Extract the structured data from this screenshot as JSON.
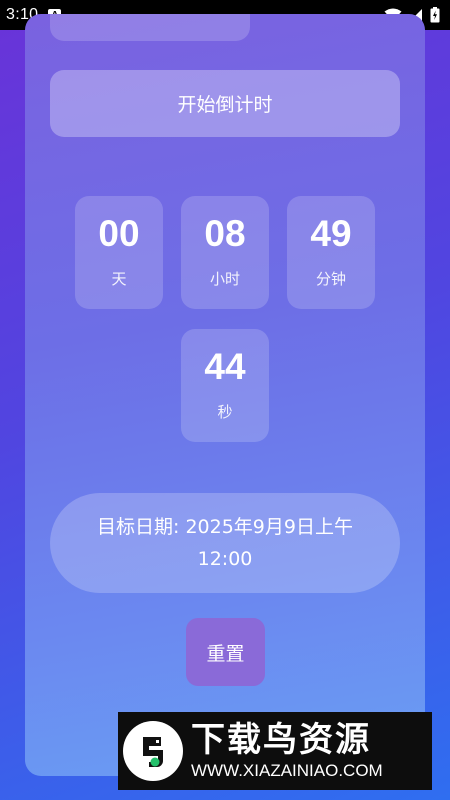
{
  "status_bar": {
    "time": "3:10",
    "notification_badge": "A"
  },
  "countdown": {
    "start_button_label": "开始倒计时",
    "units": [
      {
        "value": "00",
        "label": "天"
      },
      {
        "value": "08",
        "label": "小时"
      },
      {
        "value": "49",
        "label": "分钟"
      },
      {
        "value": "44",
        "label": "秒"
      }
    ],
    "target_date_text": "目标日期: 2025年9月9日上午12:00",
    "reset_button_label": "重置"
  },
  "watermark": {
    "title": "下载鸟资源",
    "url": "WWW.XIAZAINIAO.COM"
  },
  "colors": {
    "background_start": "#6a33d8",
    "background_end": "#2f6ef0",
    "reset_button": "#8a6ad8"
  }
}
